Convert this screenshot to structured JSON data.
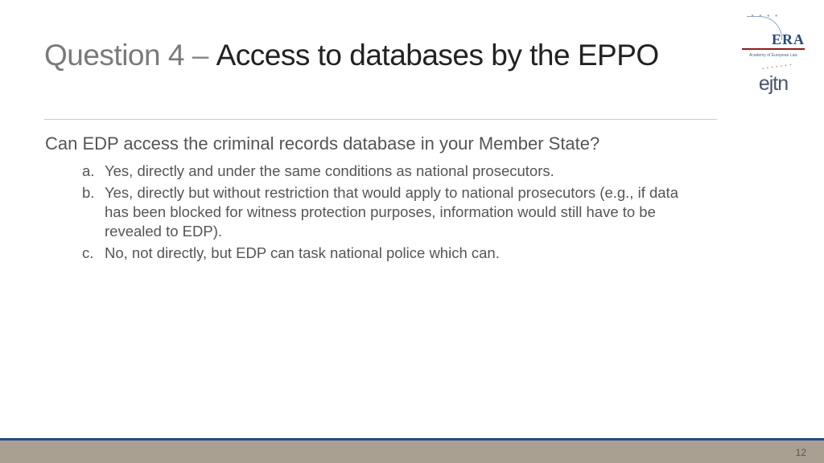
{
  "title": {
    "prefix": "Question 4",
    "dash": " – ",
    "main": "Access to databases by the EPPO"
  },
  "question": "Can EDP access the criminal records database in your Member State?",
  "options": [
    {
      "marker": "a.",
      "text": "Yes, directly and under the same conditions as national prosecutors."
    },
    {
      "marker": "b.",
      "text": "Yes, directly but without restriction that would apply to national prosecutors (e.g., if data has been blocked for witness protection purposes, information would still have to be revealed to EDP)."
    },
    {
      "marker": "c.",
      "text": "No, not directly, but EDP can task national police which can."
    }
  ],
  "logos": {
    "era_text": "ERA",
    "era_subtitle": "Academy of European Law",
    "ejtn_text": "ejtn"
  },
  "page_number": "12"
}
